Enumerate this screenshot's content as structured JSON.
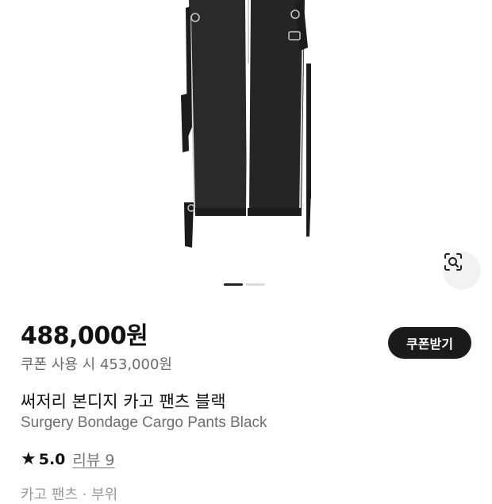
{
  "product": {
    "price": "488,000원",
    "coupon_price": "쿠폰 사용 시 453,000원",
    "coupon_button": "쿠폰받기",
    "title_ko": "써저리 본디지 카고 팬츠 블랙",
    "title_en": "Surgery Bondage Cargo Pants Black",
    "rating": "5.0",
    "review_link": "리뷰 9",
    "cut_text": "카고 팬츠 · 부위"
  },
  "gallery": {
    "current_index": 1,
    "total": 2,
    "image_name": "black cargo pants product photo"
  },
  "icons": {
    "lens": "visual-search-icon",
    "star": "star-icon"
  },
  "colors": {
    "button_bg": "#1b1b1b",
    "price_text": "#111111",
    "secondary_text": "#6e6e6e",
    "pants": "#2a2a2c"
  }
}
